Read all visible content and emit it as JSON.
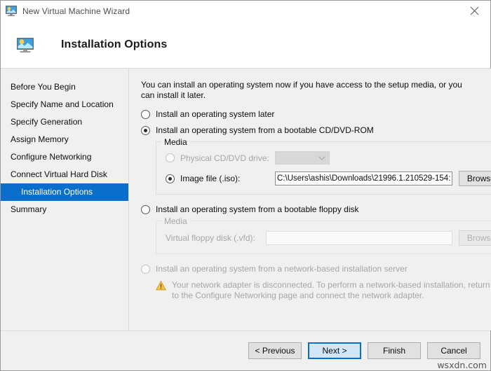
{
  "window": {
    "title": "New Virtual Machine Wizard",
    "title_icon": "virtual-machine-monitor-icon",
    "close_label": "✕",
    "accent_color": "#0a6ecb",
    "body_background": "#f0f0f0",
    "warning_color": "#f0b323"
  },
  "header": {
    "title": "Installation Options",
    "icon": "installation-options-monitor-icon"
  },
  "sidebar": {
    "items": [
      {
        "label": "Before You Begin",
        "selected": false
      },
      {
        "label": "Specify Name and Location",
        "selected": false
      },
      {
        "label": "Specify Generation",
        "selected": false
      },
      {
        "label": "Assign Memory",
        "selected": false
      },
      {
        "label": "Configure Networking",
        "selected": false
      },
      {
        "label": "Connect Virtual Hard Disk",
        "selected": false
      },
      {
        "label": "Installation Options",
        "selected": true
      },
      {
        "label": "Summary",
        "selected": false
      }
    ]
  },
  "main": {
    "intro": "You can install an operating system now if you have access to the setup media, or you can install it later.",
    "options": [
      {
        "id": "install-later",
        "label": "Install an operating system later",
        "checked": false,
        "disabled": false
      },
      {
        "id": "install-from-cd-dvd",
        "label": "Install an operating system from a bootable CD/DVD-ROM",
        "checked": true,
        "disabled": false
      },
      {
        "id": "install-from-floppy",
        "label": "Install an operating system from a bootable floppy disk",
        "checked": false,
        "disabled": false
      },
      {
        "id": "install-from-network",
        "label": "Install an operating system from a network-based installation server",
        "checked": false,
        "disabled": true
      }
    ],
    "cd_media_group": {
      "legend": "Media",
      "physical_drive": {
        "label": "Physical CD/DVD drive:",
        "checked": false,
        "disabled": true,
        "selected_option": "",
        "options": []
      },
      "image_file": {
        "label": "Image file (.iso):",
        "checked": true,
        "disabled": false,
        "value": "C:\\Users\\ashis\\Downloads\\21996.1.210529-154:",
        "placeholder": "",
        "browse_label": "Browse..."
      }
    },
    "floppy_media_group": {
      "legend": "Media",
      "virtual_floppy": {
        "label": "Virtual floppy disk (.vfd):",
        "disabled": true,
        "value": "",
        "placeholder": "",
        "browse_label": "Browse..."
      }
    },
    "network_warning": {
      "icon": "warning-triangle-icon",
      "text": "Your network adapter is disconnected. To perform a network-based installation, return to the Configure Networking page and connect the network adapter."
    }
  },
  "footer": {
    "buttons": [
      {
        "label": "< Previous",
        "default": false
      },
      {
        "label": "Next >",
        "default": true
      },
      {
        "label": "Finish",
        "default": false
      },
      {
        "label": "Cancel",
        "default": false
      }
    ]
  },
  "watermark": {
    "text": "wsxdn.com"
  }
}
